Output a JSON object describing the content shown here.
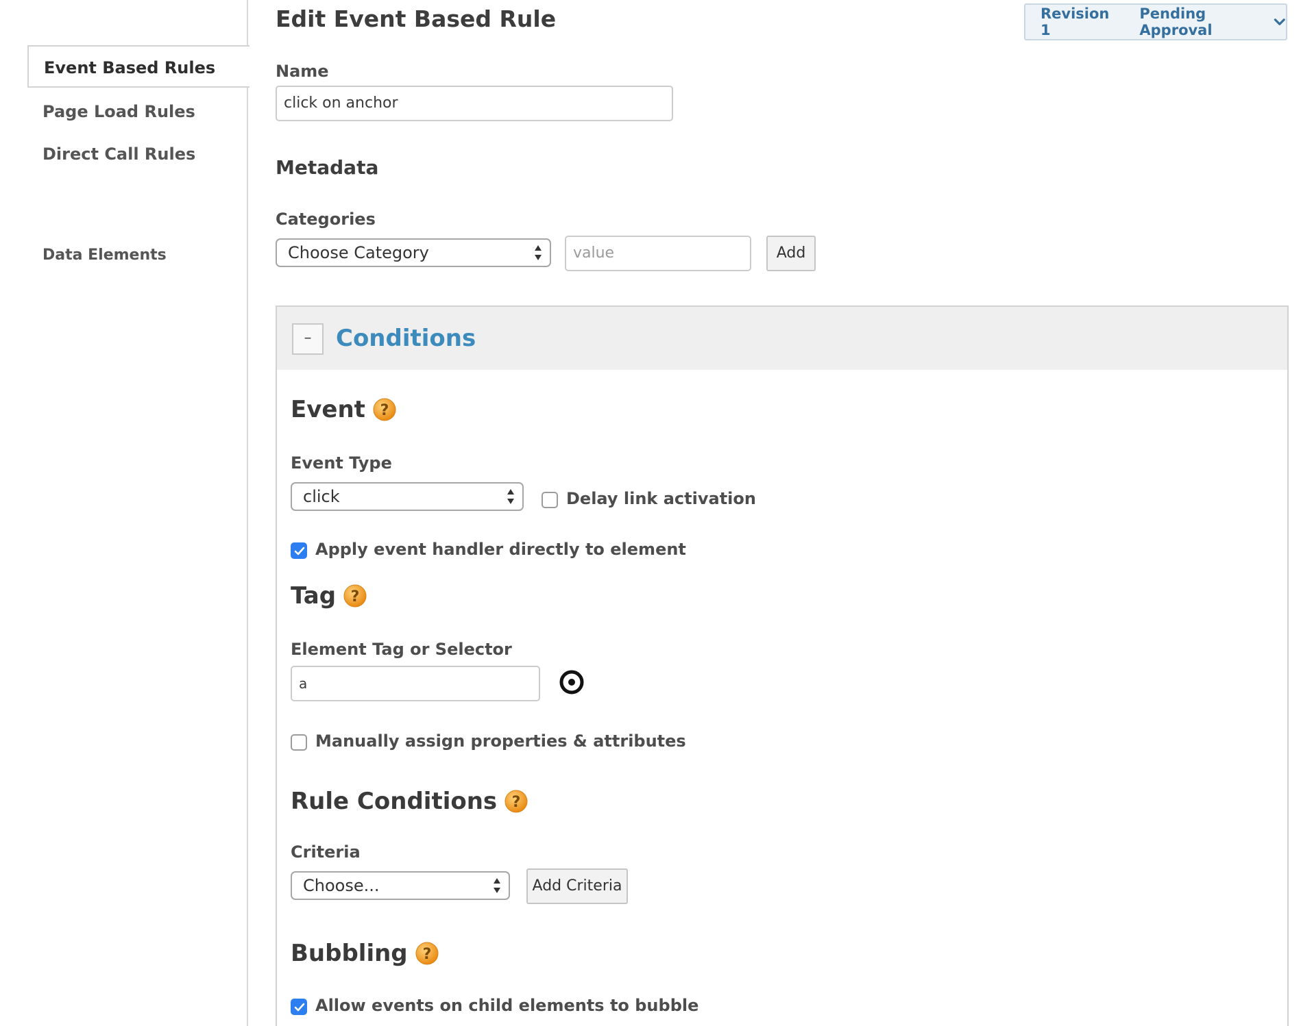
{
  "sidebar": {
    "items": [
      {
        "label": "Event Based Rules",
        "active": true
      },
      {
        "label": "Page Load Rules"
      },
      {
        "label": "Direct Call Rules"
      },
      {
        "label": "Data Elements"
      }
    ]
  },
  "header": {
    "title": "Edit Event Based Rule",
    "revision": "Revision 1",
    "status": "Pending Approval"
  },
  "form": {
    "name_label": "Name",
    "name_value": "click on anchor",
    "metadata_title": "Metadata",
    "categories_label": "Categories",
    "category_select": "Choose Category",
    "value_placeholder": "value",
    "add_button": "Add"
  },
  "conditions": {
    "collapse_symbol": "–",
    "title": "Conditions",
    "event": {
      "title": "Event",
      "type_label": "Event Type",
      "type_value": "click",
      "delay_label": "Delay link activation",
      "delay_checked": false,
      "apply_label": "Apply event handler directly to element",
      "apply_checked": true
    },
    "tag": {
      "title": "Tag",
      "selector_label": "Element Tag or Selector",
      "selector_value": "a",
      "manual_label": "Manually assign properties & attributes",
      "manual_checked": false
    },
    "rule_conditions": {
      "title": "Rule Conditions",
      "criteria_label": "Criteria",
      "criteria_select": "Choose...",
      "add_criteria_button": "Add Criteria"
    },
    "bubbling": {
      "title": "Bubbling",
      "allow_label": "Allow events on child elements to bubble",
      "allow_checked": true
    }
  },
  "colors": {
    "accent_blue": "#3d8bbd",
    "checkbox_blue": "#2d7ef0",
    "help_orange": "#f0a032",
    "revision_text": "#356f9e"
  }
}
